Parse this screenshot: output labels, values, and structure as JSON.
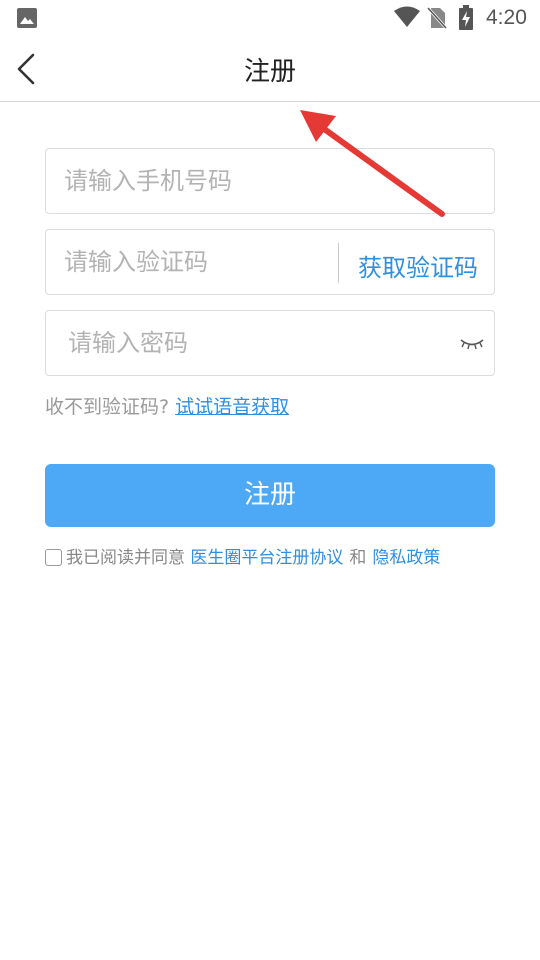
{
  "status_bar": {
    "time": "4:20",
    "icons": [
      "image-icon",
      "wifi-icon",
      "no-sim-icon",
      "battery-charging-icon"
    ]
  },
  "header": {
    "title": "注册",
    "back_icon": "chevron-left-icon"
  },
  "form": {
    "phone_placeholder": "请输入手机号码",
    "code_placeholder": "请输入验证码",
    "get_code_label": "获取验证码",
    "password_placeholder": "请输入密码",
    "password_toggle_icon": "eye-closed-icon"
  },
  "voice": {
    "prompt": "收不到验证码?",
    "link": "试试语音获取"
  },
  "register_button": "注册",
  "agreement": {
    "text": "我已阅读并同意",
    "terms_link": "医生圈平台注册协议",
    "and": "和",
    "privacy_link": "隐私政策"
  },
  "colors": {
    "accent": "#4da8f5",
    "link": "#2f8fe0",
    "annotation_arrow": "#e53935"
  }
}
